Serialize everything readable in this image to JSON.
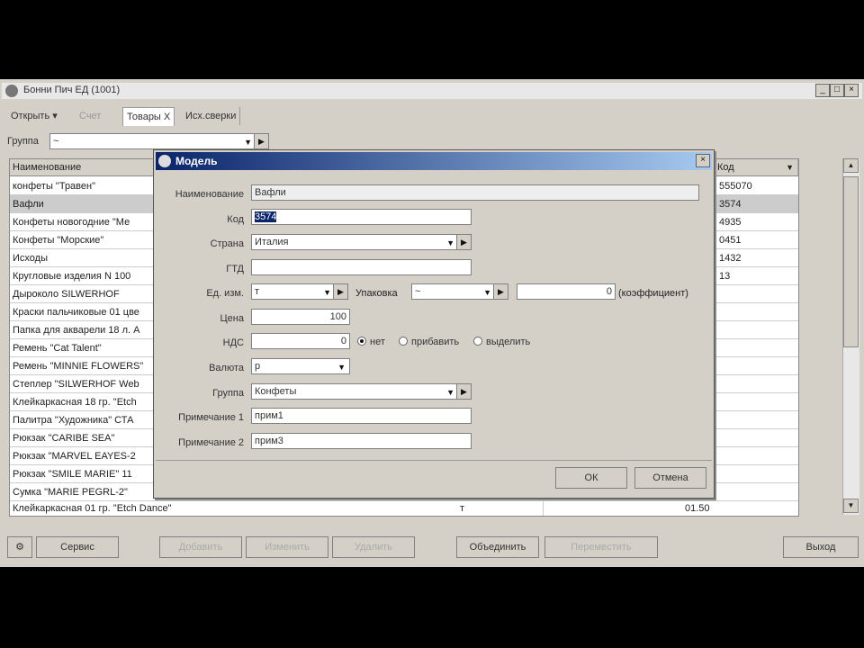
{
  "window": {
    "title": "Бонни Пич ЕД (1001)",
    "min": "_",
    "max": "□",
    "close": "×"
  },
  "toolbar": {
    "tabs": [
      "Открыть ▾",
      "Счет",
      "Товары Х",
      "Исх.сверки"
    ]
  },
  "group_filter": {
    "label": "Группа",
    "value": "~"
  },
  "grid": {
    "headers": {
      "name": "Наименование",
      "code": "Код"
    },
    "rows": [
      {
        "name": "конфеты \"Травен\"",
        "code": "555070"
      },
      {
        "name": "Вафли",
        "code": "3574"
      },
      {
        "name": "Конфеты новогодние \"Ме",
        "code": "4935"
      },
      {
        "name": "Конфеты \"Морские\"",
        "code": "0451"
      },
      {
        "name": "Исходы",
        "code": "1432"
      },
      {
        "name": "Кругловые изделия N 100",
        "code": "13"
      },
      {
        "name": "Дыроколо SILWERHOF",
        "code": ""
      },
      {
        "name": "Краски пальчиковые 01 цве",
        "code": ""
      },
      {
        "name": "Папка для акварели 18 л. А",
        "code": ""
      },
      {
        "name": "Ремень \"Cat Talent\"",
        "code": ""
      },
      {
        "name": "Ремень \"MINNIE FLOWERS\"",
        "code": ""
      },
      {
        "name": "Степлер \"SILWERHOF Web",
        "code": ""
      },
      {
        "name": "Клейкаркасная 18 гр. \"Etch",
        "code": ""
      },
      {
        "name": "Палитра \"Художника\" СТА",
        "code": ""
      },
      {
        "name": "Рюкзак \"CARIBE SEA\"",
        "code": ""
      },
      {
        "name": "Рюкзак \"MARVEL EAYES-2",
        "code": ""
      },
      {
        "name": "Рюкзак \"SMILE MARIE\" 11",
        "code": ""
      },
      {
        "name": "Сумка \"MARIE PEGRL-2\"",
        "code": ""
      }
    ],
    "last_row": {
      "name": "Клейкаркасная 01 гр. \"Etch Dance\"",
      "unit": "т",
      "price": "01.50"
    }
  },
  "bottom_buttons": [
    "Сервис",
    "Добавить",
    "Изменить",
    "Удалить",
    "Объединить",
    "Переместить",
    "Выход"
  ],
  "dialog": {
    "title": "Модель",
    "close": "×",
    "labels": {
      "name": "Наименование",
      "code": "Код",
      "country": "Страна",
      "gtd": "ГТД",
      "unit": "Ед. изм.",
      "package": "Упаковка",
      "coefficient": "(коэффициент)",
      "price": "Цена",
      "vat": "НДС",
      "currency": "Валюта",
      "group": "Группа",
      "note1": "Примечание 1",
      "note2": "Примечание 2"
    },
    "values": {
      "name": "Вафли",
      "code": "3574",
      "country": "Италия",
      "gtd": "",
      "unit": "т",
      "package": "~",
      "coefficient": "0",
      "price": "100",
      "vat": "0",
      "currency": "р",
      "group": "Конфеты",
      "note1": "прим1",
      "note2": "прим3"
    },
    "vat_options": [
      "нет",
      "прибавить",
      "выделить"
    ],
    "vat_selected": 0,
    "ok": "ОК",
    "cancel": "Отмена"
  }
}
